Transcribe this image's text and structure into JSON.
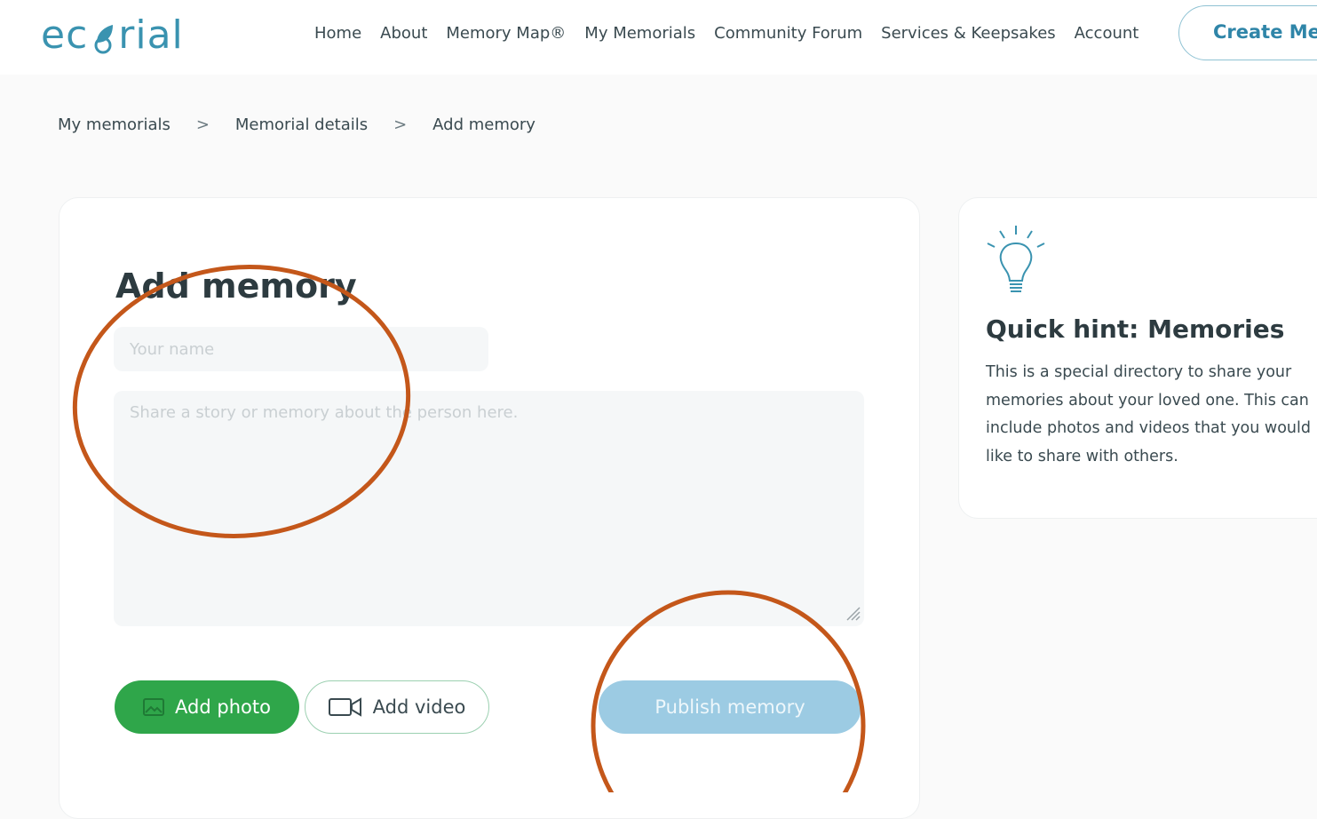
{
  "header": {
    "logo_text": "ecorial",
    "nav": [
      "Home",
      "About",
      "Memory Map®",
      "My Memorials",
      "Community Forum",
      "Services & Keepsakes",
      "Account"
    ],
    "create_button": "Create Memorial"
  },
  "breadcrumb": [
    "My memorials",
    "Memorial details",
    "Add memory"
  ],
  "breadcrumb_sep": ">",
  "form": {
    "title": "Add memory",
    "name_placeholder": "Your name",
    "story_placeholder": "Share a story or memory about the person here.",
    "add_photo": "Add photo",
    "add_video": "Add video",
    "publish": "Publish memory"
  },
  "hint": {
    "title": "Quick hint: Memories",
    "text": "This is a special directory to share your memories about your loved one. This can include photos and videos that you would like to share with others."
  },
  "colors": {
    "brand": "#3a93b0",
    "green": "#2fa64a",
    "publish": "#9ccbe3",
    "annotation": "#c4571a"
  }
}
